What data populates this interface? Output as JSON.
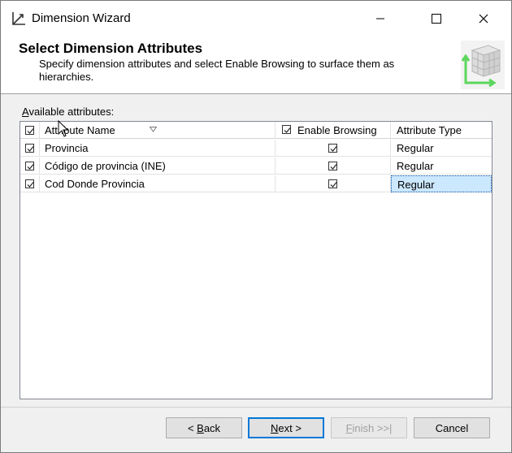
{
  "window": {
    "title": "Dimension Wizard"
  },
  "header": {
    "title": "Select Dimension Attributes",
    "description": "Specify dimension attributes and select Enable Browsing to surface them as hierarchies."
  },
  "attributes": {
    "label_prefix": "A",
    "label_rest": "vailable attributes:",
    "columns": {
      "name": "Attribute Name",
      "browsing": "Enable Browsing",
      "type": "Attribute Type"
    },
    "rows": [
      {
        "checked": true,
        "name": "Provincia",
        "browsing": true,
        "type": "Regular"
      },
      {
        "checked": true,
        "name": "Código de provincia (INE)",
        "browsing": true,
        "type": "Regular"
      },
      {
        "checked": true,
        "name": "Cod Donde Provincia",
        "browsing": true,
        "type": "Regular",
        "selected": true
      }
    ]
  },
  "buttons": {
    "back_prefix": "< ",
    "back_key": "B",
    "back_rest": "ack",
    "next_key": "N",
    "next_rest": "ext >",
    "finish_key": "F",
    "finish_rest": "inish >>|",
    "cancel": "Cancel"
  },
  "colors": {
    "accent": "#0078d7",
    "selection": "#cce8ff"
  },
  "icons": [
    "wizard-icon",
    "minimize-icon",
    "maximize-icon",
    "close-icon",
    "sort-icon",
    "cube-icon"
  ]
}
